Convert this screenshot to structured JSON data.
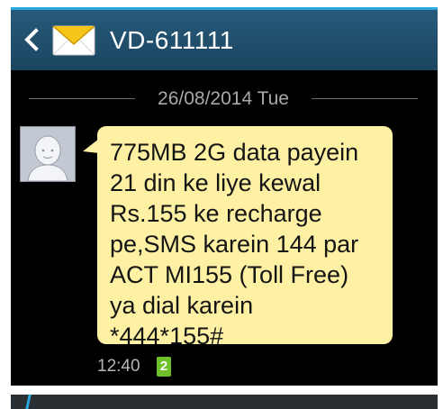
{
  "header": {
    "contact": "VD-611111",
    "back_icon": "chevron-left-icon",
    "avatar_icon": "envelope-icon"
  },
  "conversation": {
    "date_separator": "26/08/2014 Tue",
    "message": {
      "text": "775MB 2G data payein\n21 din ke liye kewal\nRs.155 ke recharge\npe,SMS karein 144 par\nACT MI155 (Toll Free)\nya dial karein\n*444*155#",
      "time": "12:40",
      "sim_badge": "2"
    }
  },
  "colors": {
    "header": "#1f4d6b",
    "bubble": "#fff1a3",
    "accent": "#2aa9e0",
    "sim_badge": "#6fc12a"
  }
}
